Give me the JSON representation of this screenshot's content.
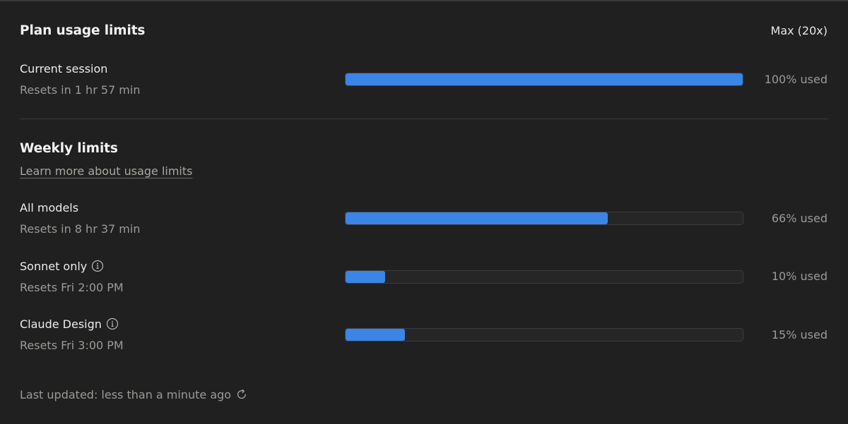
{
  "plan": {
    "title": "Plan usage limits",
    "tier": "Max (20x)"
  },
  "session": {
    "label": "Current session",
    "reset": "Resets in 1 hr 57 min",
    "percent": 100,
    "percent_label": "100% used"
  },
  "weekly": {
    "title": "Weekly limits",
    "learn_more": "Learn more about usage limits",
    "items": [
      {
        "label": "All models",
        "reset": "Resets in 8 hr 37 min",
        "percent": 66,
        "percent_label": "66% used",
        "has_info": false
      },
      {
        "label": "Sonnet only",
        "reset": "Resets Fri 2:00 PM",
        "percent": 10,
        "percent_label": "10% used",
        "has_info": true
      },
      {
        "label": "Claude Design",
        "reset": "Resets Fri 3:00 PM",
        "percent": 15,
        "percent_label": "15% used",
        "has_info": true
      }
    ]
  },
  "footer": {
    "last_updated": "Last updated: less than a minute ago"
  },
  "colors": {
    "background": "#202020",
    "bar_fill": "#3A85E6",
    "bar_track": "#262626",
    "muted_text": "#9A9A96"
  },
  "icons": {
    "info": "info-circle-icon",
    "refresh": "refresh-icon"
  }
}
